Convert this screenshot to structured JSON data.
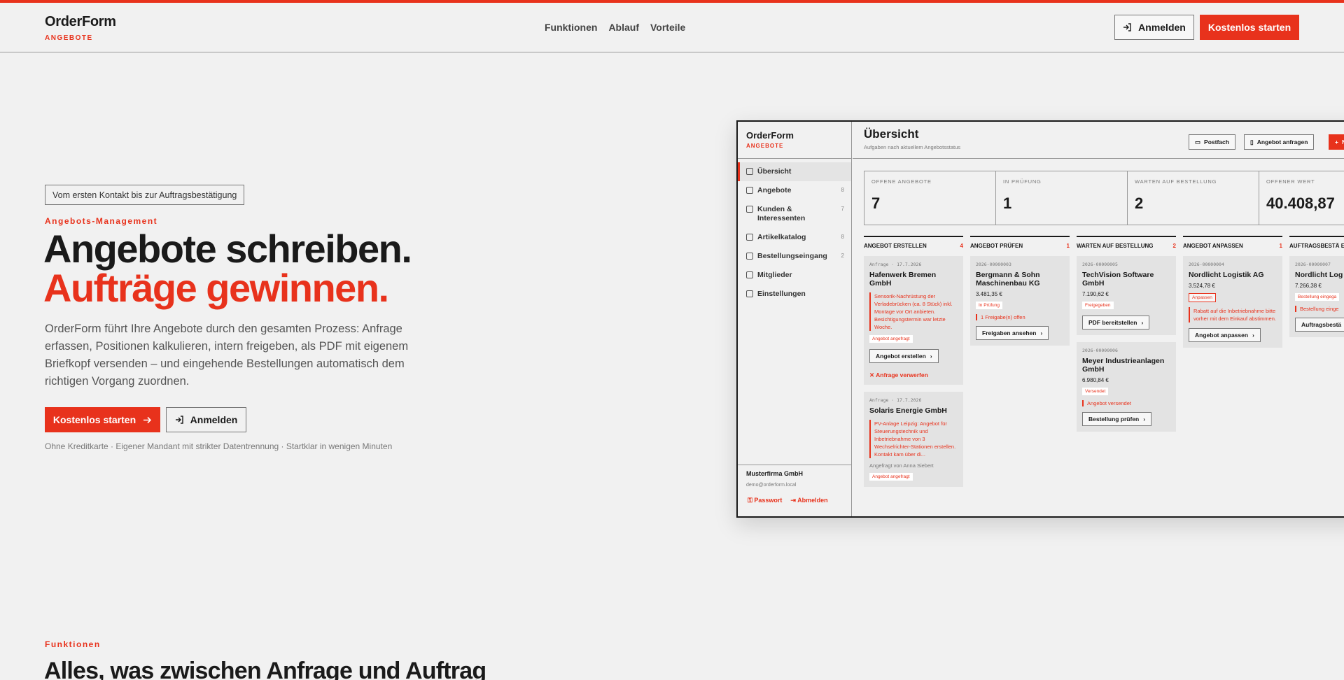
{
  "colors": {
    "accent": "#e8321c",
    "background": "#f1f1f1",
    "text": "#1a1a1a"
  },
  "header": {
    "brand": "OrderForm",
    "brand_sub": "ANGEBOTE",
    "nav": [
      "Funktionen",
      "Ablauf",
      "Vorteile"
    ],
    "login_label": "Anmelden",
    "start_label": "Kostenlos starten"
  },
  "hero": {
    "badge": "Vom ersten Kontakt bis zur Auftragsbestätigung",
    "eyebrow": "Angebots-Management",
    "title_line1": "Angebote schreiben.",
    "title_line2": "Aufträge gewinnen.",
    "lead": "OrderForm führt Ihre Angebote durch den gesamten Prozess: Anfrage erfassen, Positionen kalkulieren, intern freigeben, als PDF mit eigenem Briefkopf versenden – und eingehende Bestellungen automatisch dem richtigen Vorgang zuordnen.",
    "cta_start": "Kostenlos starten",
    "cta_login": "Anmelden",
    "fineprint": "Ohne Kreditkarte · Eigener Mandant mit strikter Datentrennung · Startklar in wenigen Minuten"
  },
  "features": {
    "eyebrow": "Funktionen",
    "title": "Alles, was zwischen Anfrage und Auftrag"
  },
  "app": {
    "brand": "OrderForm",
    "brand_sub": "ANGEBOTE",
    "sidebar": [
      {
        "label": "Übersicht",
        "count": "",
        "icon": "grid-icon"
      },
      {
        "label": "Angebote",
        "count": "8",
        "icon": "document-icon"
      },
      {
        "label": "Kunden & Interessenten",
        "count": "7",
        "icon": "users-icon"
      },
      {
        "label": "Artikelkatalog",
        "count": "8",
        "icon": "box-icon"
      },
      {
        "label": "Bestellungseingang",
        "count": "2",
        "icon": "inbox-icon"
      },
      {
        "label": "Mitglieder",
        "count": "",
        "icon": "user-icon"
      },
      {
        "label": "Einstellungen",
        "count": "",
        "icon": "gear-icon"
      }
    ],
    "company": "Musterfirma GmbH",
    "email": "demo@orderform.local",
    "password_link": "Passwort",
    "logout_link": "Abmelden",
    "title": "Übersicht",
    "subtitle": "Aufgaben nach aktuellem Angebotsstatus",
    "buttons": {
      "inbox": "Postfach",
      "request": "Angebot anfragen",
      "new": "Ne"
    },
    "stats": [
      {
        "label": "OFFENE ANGEBOTE",
        "value": "7"
      },
      {
        "label": "IN PRÜFUNG",
        "value": "1"
      },
      {
        "label": "WARTEN AUF BESTELLUNG",
        "value": "2"
      },
      {
        "label": "OFFENER WERT",
        "value": "40.408,87"
      }
    ],
    "columns": [
      {
        "title": "ANGEBOT ERSTELLEN",
        "count": "4"
      },
      {
        "title": "ANGEBOT PRÜFEN",
        "count": "1"
      },
      {
        "title": "WARTEN AUF BESTELLUNG",
        "count": "2"
      },
      {
        "title": "ANGEBOT ANPASSEN",
        "count": "1"
      },
      {
        "title": "AUFTRAGSBESTÄ ERZEUGEN",
        "count": ""
      }
    ],
    "cards": {
      "c1": {
        "meta": "Anfrage · 17.7.2026",
        "name": "Hafenwerk Bremen GmbH",
        "note": "Sensorik-Nachrüstung der Verladebrücken (ca. 8 Stück) inkl. Montage vor Ort anbieten. Besichtigungstermin war letzte Woche.",
        "tag": "Angebot angefragt",
        "action": "Angebot erstellen",
        "link": "Anfrage verwerfen"
      },
      "c2": {
        "meta": "Anfrage · 17.7.2026",
        "name": "Solaris Energie GmbH",
        "note": "PV-Anlage Leipzig: Angebot für Steuerungstechnik und Inbetriebnahme von 3 Wechselrichter-Stationen erstellen. Kontakt kam über di...",
        "info": "Angefragt von Anna Siebert",
        "tag": "Angebot angefragt"
      },
      "c3": {
        "meta": "2026-00000003",
        "name": "Bergmann & Sohn Maschinenbau KG",
        "amount": "3.481,35 €",
        "tag": "In Prüfung",
        "line": "1 Freigabe(n) offen",
        "action": "Freigaben ansehen"
      },
      "c4": {
        "meta": "2026-00000005",
        "name": "TechVision Software GmbH",
        "amount": "7.190,62 €",
        "tag": "Freigegeben",
        "action": "PDF bereitstellen"
      },
      "c5": {
        "meta": "2026-00000006",
        "name": "Meyer Industrieanlagen GmbH",
        "amount": "6.980,84 €",
        "tag": "Versendet",
        "line": "Angebot versendet",
        "action": "Bestellung prüfen"
      },
      "c6": {
        "meta": "2026-00000004",
        "name": "Nordlicht Logistik AG",
        "amount": "3.524,78 €",
        "tag": "Anpassen",
        "note": "Rabatt auf die Inbetriebnahme bitte vorher mit dem Einkauf abstimmen.",
        "action": "Angebot anpassen"
      },
      "c7": {
        "meta": "2026-00000007",
        "name": "Nordlicht Log",
        "amount": "7.266,38 €",
        "tag": "Bestellung eingega",
        "line": "Bestellung einge",
        "action": "Auftragsbestä"
      }
    }
  }
}
